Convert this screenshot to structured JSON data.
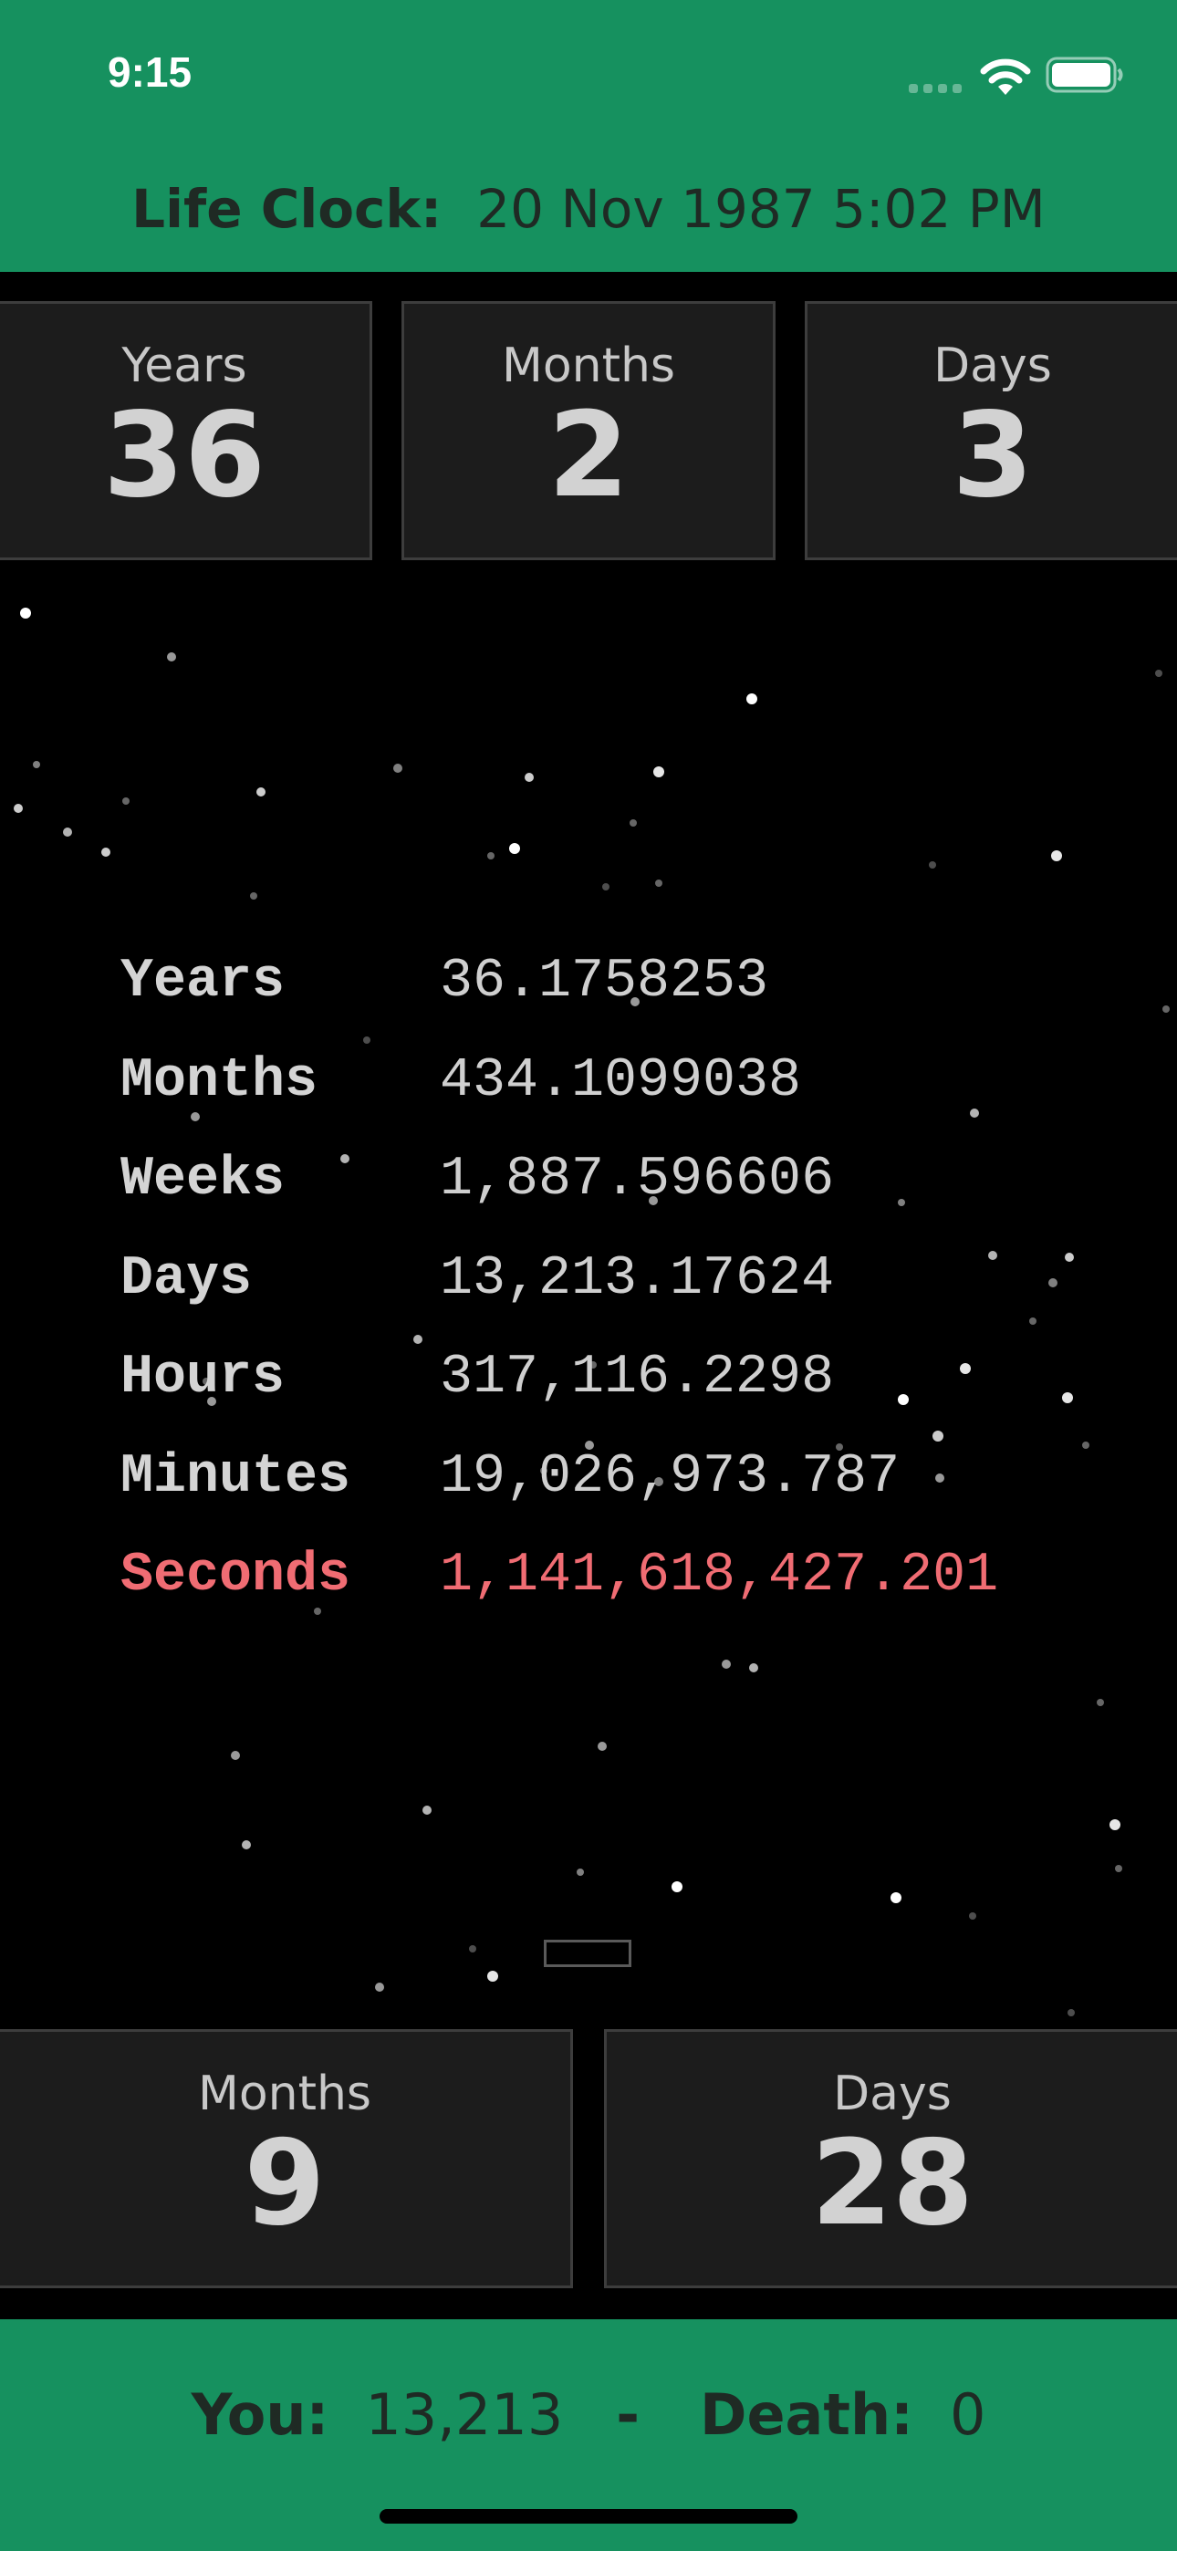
{
  "status": {
    "time": "9:15"
  },
  "header": {
    "label": "Life Clock:",
    "birth": "20 Nov 1987 5:02 PM"
  },
  "top_stats": [
    {
      "label": "Years",
      "value": "36"
    },
    {
      "label": "Months",
      "value": "2"
    },
    {
      "label": "Days",
      "value": "3"
    }
  ],
  "counters": [
    {
      "label": "Years",
      "value": "36.1758253"
    },
    {
      "label": "Months",
      "value": "434.1099038"
    },
    {
      "label": "Weeks",
      "value": "1,887.596606"
    },
    {
      "label": "Days",
      "value": "13,213.17624"
    },
    {
      "label": "Hours",
      "value": "317,116.2298"
    },
    {
      "label": "Minutes",
      "value": "19,026,973.787"
    },
    {
      "label": "Seconds",
      "value": "1,141,618,427.201"
    }
  ],
  "bottom_stats": [
    {
      "label": "Months",
      "value": "9"
    },
    {
      "label": "Days",
      "value": "28"
    }
  ],
  "footer": {
    "you_label": "You:",
    "you_value": "13,213",
    "separator": "-",
    "death_label": "Death:",
    "death_value": "0"
  },
  "colors": {
    "accent": "#16915f",
    "highlight": "#f06c73",
    "box": "#1c1c1c"
  }
}
